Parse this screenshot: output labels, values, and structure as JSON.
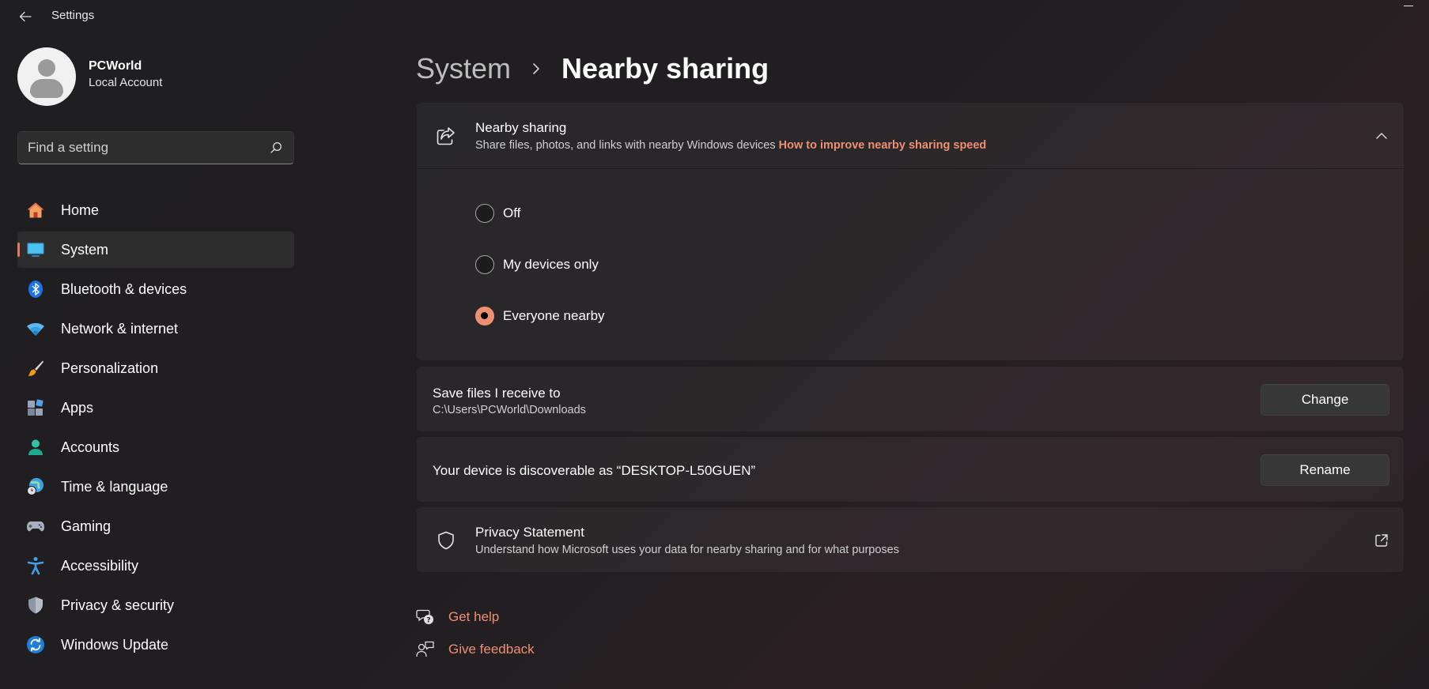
{
  "window": {
    "title": "Settings"
  },
  "profile": {
    "name": "PCWorld",
    "account_type": "Local Account"
  },
  "search": {
    "placeholder": "Find a setting"
  },
  "sidebar": {
    "items": [
      {
        "label": "Home",
        "icon": "home-icon",
        "active": false
      },
      {
        "label": "System",
        "icon": "system-icon",
        "active": true
      },
      {
        "label": "Bluetooth & devices",
        "icon": "bluetooth-icon",
        "active": false
      },
      {
        "label": "Network & internet",
        "icon": "wifi-icon",
        "active": false
      },
      {
        "label": "Personalization",
        "icon": "brush-icon",
        "active": false
      },
      {
        "label": "Apps",
        "icon": "apps-icon",
        "active": false
      },
      {
        "label": "Accounts",
        "icon": "accounts-icon",
        "active": false
      },
      {
        "label": "Time & language",
        "icon": "globe-clock-icon",
        "active": false
      },
      {
        "label": "Gaming",
        "icon": "gamepad-icon",
        "active": false
      },
      {
        "label": "Accessibility",
        "icon": "accessibility-icon",
        "active": false
      },
      {
        "label": "Privacy & security",
        "icon": "shield-icon",
        "active": false
      },
      {
        "label": "Windows Update",
        "icon": "update-icon",
        "active": false
      }
    ]
  },
  "breadcrumb": {
    "parent": "System",
    "current": "Nearby sharing"
  },
  "nearby_card": {
    "title": "Nearby sharing",
    "description": "Share files, photos, and links with nearby Windows devices",
    "link": "How to improve nearby sharing speed",
    "options": [
      {
        "label": "Off",
        "checked": false
      },
      {
        "label": "My devices only",
        "checked": false
      },
      {
        "label": "Everyone nearby",
        "checked": true
      }
    ]
  },
  "save_files": {
    "title": "Save files I receive to",
    "path": "C:\\Users\\PCWorld\\Downloads",
    "button": "Change"
  },
  "discoverable": {
    "title": "Your device is discoverable as “DESKTOP-L50GUEN”",
    "button": "Rename"
  },
  "privacy": {
    "title": "Privacy Statement",
    "description": "Understand how Microsoft uses your data for nearby sharing and for what purposes"
  },
  "help": {
    "get_help": "Get help",
    "give_feedback": "Give feedback"
  },
  "colors": {
    "accent": "#ef8f72",
    "background": "#202020",
    "card": "#2b2a2c"
  }
}
